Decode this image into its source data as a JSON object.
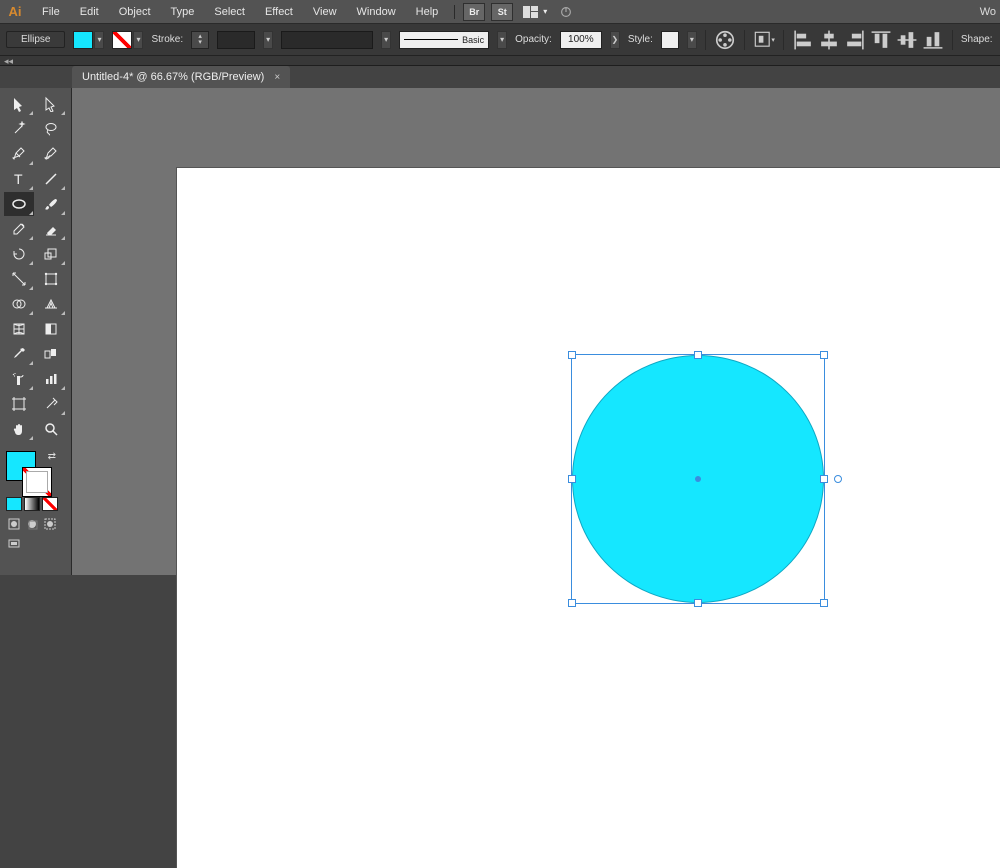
{
  "app": {
    "logo": "Ai",
    "wo": "Wo"
  },
  "menu": [
    "File",
    "Edit",
    "Object",
    "Type",
    "Select",
    "Effect",
    "View",
    "Window",
    "Help"
  ],
  "ext": {
    "br": "Br",
    "st": "St"
  },
  "control": {
    "mode": "Ellipse",
    "fill_color": "#15e7ff",
    "stroke_label": "Stroke:",
    "brush_label": "Basic",
    "opacity_label": "Opacity:",
    "opacity_value": "100%",
    "style_label": "Style:",
    "shape_label": "Shape:"
  },
  "tab": {
    "title": "Untitled-4* @ 66.67% (RGB/Preview)",
    "close": "×"
  },
  "colors": {
    "swatch": "#15e7ff",
    "white": "#ffffff",
    "sel_blue": "#3a8dde"
  }
}
